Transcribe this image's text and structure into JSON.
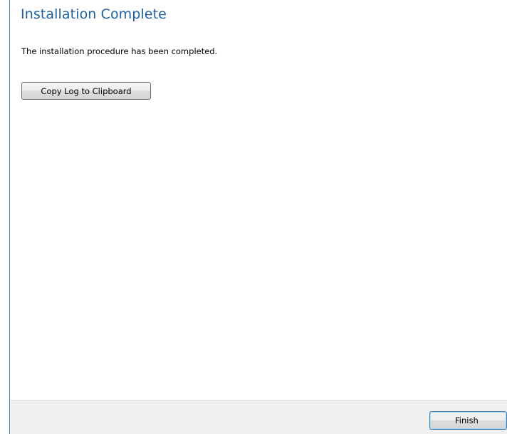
{
  "page": {
    "title": "Installation Complete",
    "message": "The installation procedure has been completed."
  },
  "actions": {
    "copy_log_label": "Copy Log to Clipboard",
    "finish_label": "Finish"
  },
  "colors": {
    "title": "#1e5f9e",
    "window_edge": "#4a87c8",
    "footer_background": "#f0f0f0",
    "default_button_border": "#3c7fb1"
  }
}
